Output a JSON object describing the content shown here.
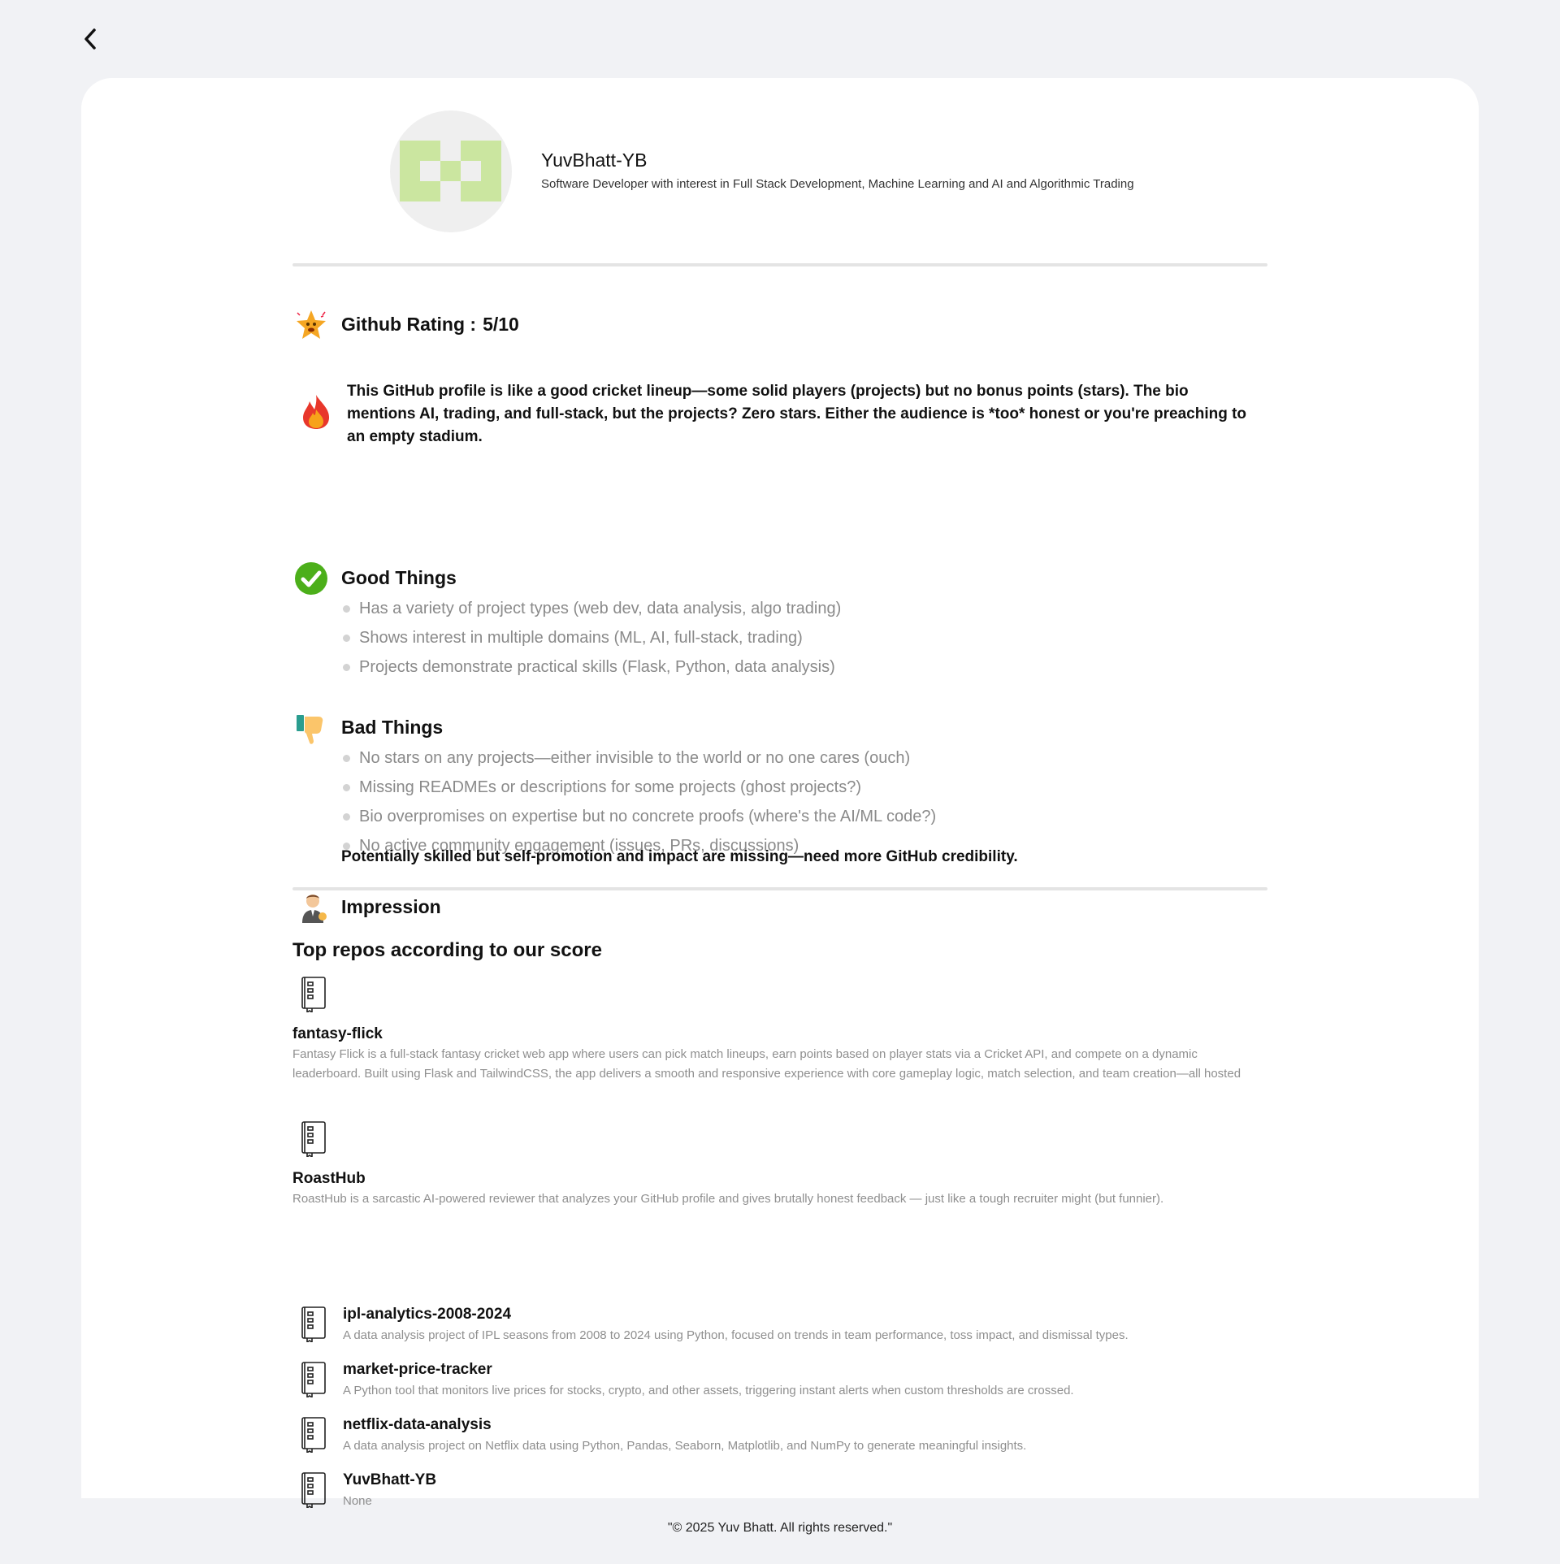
{
  "profile": {
    "name": "YuvBhatt-YB",
    "bio": "Software Developer with interest in Full Stack Development, Machine Learning and AI and Algorithmic Trading"
  },
  "rating": {
    "label": "Github Rating :",
    "value": "5/10"
  },
  "roast": "This GitHub profile is like a good cricket lineup—some solid players (projects) but no bonus points (stars). The bio mentions AI, trading, and full-stack, but the projects? Zero stars. Either the audience is *too* honest or you're preaching to an empty stadium.",
  "good": {
    "title": "Good Things",
    "items": [
      "Has a variety of project types (web dev, data analysis, algo trading)",
      "Shows interest in multiple domains (ML, AI, full-stack, trading)",
      "Projects demonstrate practical skills (Flask, Python, data analysis)"
    ]
  },
  "bad": {
    "title": "Bad Things",
    "items": [
      "No stars on any projects—either invisible to the world or no one cares (ouch)",
      "Missing READMEs or descriptions for some projects (ghost projects?)",
      "Bio overpromises on expertise but no concrete proofs (where's the AI/ML code?)",
      "No active community engagement (issues, PRs, discussions)"
    ]
  },
  "impression": {
    "title": "Impression",
    "text": "Potentially skilled but self-promotion and impact are missing—need more GitHub credibility."
  },
  "top_repos": {
    "title": "Top repos according to our score",
    "repos": [
      {
        "name": "fantasy-flick",
        "description": "Fantasy Flick is a full-stack fantasy cricket web app where users can pick match lineups, earn points based on player stats via a Cricket API, and compete on a dynamic leaderboard. Built using Flask and TailwindCSS, the app delivers a smooth and responsive experience with core gameplay logic, match selection, and team creation—all hosted"
      },
      {
        "name": "RoastHub",
        "description": "RoastHub is a sarcastic AI-powered reviewer that analyzes your GitHub profile and gives brutally honest feedback — just like a tough recruiter might (but funnier)."
      },
      {
        "name": "ipl-analytics-2008-2024",
        "description": "A data analysis project of IPL seasons from 2008 to 2024 using Python, focused on trends in team performance, toss impact, and dismissal types."
      },
      {
        "name": "market-price-tracker",
        "description": "A Python tool that monitors live prices for stocks, crypto, and other assets, triggering instant alerts when custom thresholds are crossed."
      },
      {
        "name": "netflix-data-analysis",
        "description": "A data analysis project on Netflix data using Python, Pandas, Seaborn, Matplotlib, and NumPy to generate meaningful insights."
      },
      {
        "name": "YuvBhatt-YB",
        "description": "None"
      }
    ]
  },
  "footer": "\"© 2025 Yuv Bhatt. All rights reserved.\"",
  "icons": {
    "back": "chevron-left-icon",
    "rating": "star-face-icon",
    "roast": "fire-icon",
    "good": "check-icon",
    "bad": "thumbs-down-icon",
    "impression": "person-icon",
    "repo": "book-icon"
  },
  "colors": {
    "avatar_pattern": "#cbe6a0",
    "check_green": "#4caf1a"
  }
}
